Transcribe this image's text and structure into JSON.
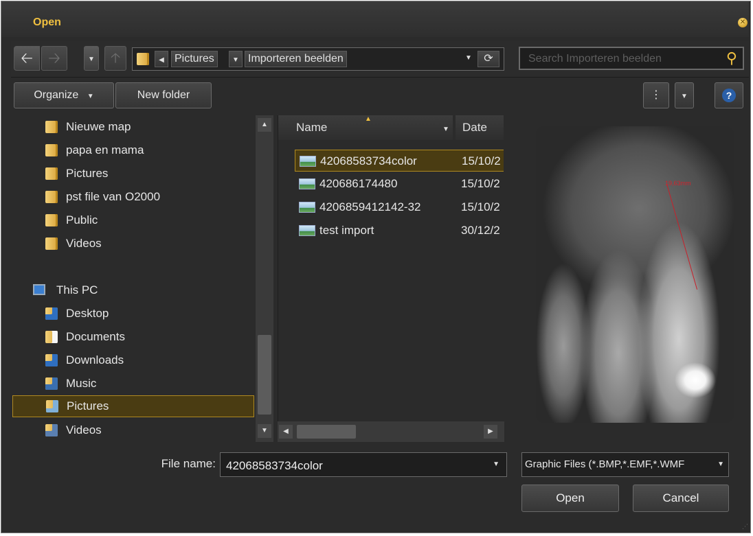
{
  "window": {
    "title": "Open",
    "close_icon": "close-icon"
  },
  "nav": {
    "back_icon": "back-arrow-icon",
    "forward_icon": "forward-arrow-icon",
    "recent_icon": "recent-locations-dropdown-icon",
    "up_icon": "up-arrow-icon",
    "breadcrumb": [
      "Pictures",
      "Importeren beelden"
    ],
    "refresh_icon": "refresh-icon",
    "search_placeholder": "Search Importeren beelden",
    "search_icon": "search-icon"
  },
  "toolbar": {
    "organize_label": "Organize",
    "new_folder_label": "New folder",
    "view_icon": "view-options-icon",
    "help_icon": "help-icon"
  },
  "tree": {
    "items": [
      {
        "label": "Nieuwe map",
        "icon": "folder-icon"
      },
      {
        "label": "papa en mama",
        "icon": "folder-icon"
      },
      {
        "label": "Pictures",
        "icon": "folder-icon"
      },
      {
        "label": "pst file van O2000",
        "icon": "folder-icon"
      },
      {
        "label": "Public",
        "icon": "folder-icon"
      },
      {
        "label": "Videos",
        "icon": "folder-icon"
      },
      {
        "label": "This PC",
        "icon": "computer-icon"
      },
      {
        "label": "Desktop",
        "icon": "desktop-folder-icon"
      },
      {
        "label": "Documents",
        "icon": "documents-folder-icon"
      },
      {
        "label": "Downloads",
        "icon": "downloads-folder-icon"
      },
      {
        "label": "Music",
        "icon": "music-folder-icon"
      },
      {
        "label": "Pictures",
        "icon": "pictures-folder-icon",
        "selected": true
      },
      {
        "label": "Videos",
        "icon": "videos-folder-icon"
      }
    ]
  },
  "files": {
    "columns": [
      "Name",
      "Date"
    ],
    "rows": [
      {
        "name": "42068583734color",
        "date": "15/10/2",
        "selected": true
      },
      {
        "name": "420686174480",
        "date": "15/10/2"
      },
      {
        "name": "4206859412142-32",
        "date": "15/10/2"
      },
      {
        "name": "test import",
        "date": "30/12/2"
      }
    ]
  },
  "preview": {
    "measurement_label": "19,63mm"
  },
  "footer": {
    "file_name_label": "File name:",
    "file_name_value": "42068583734color",
    "filter_value": "Graphic Files (*.BMP,*.EMF,*.WMF",
    "open_label": "Open",
    "cancel_label": "Cancel"
  },
  "colors": {
    "accent": "#f0c040",
    "selection_border": "#b08a20",
    "background": "#2b2b2b"
  }
}
